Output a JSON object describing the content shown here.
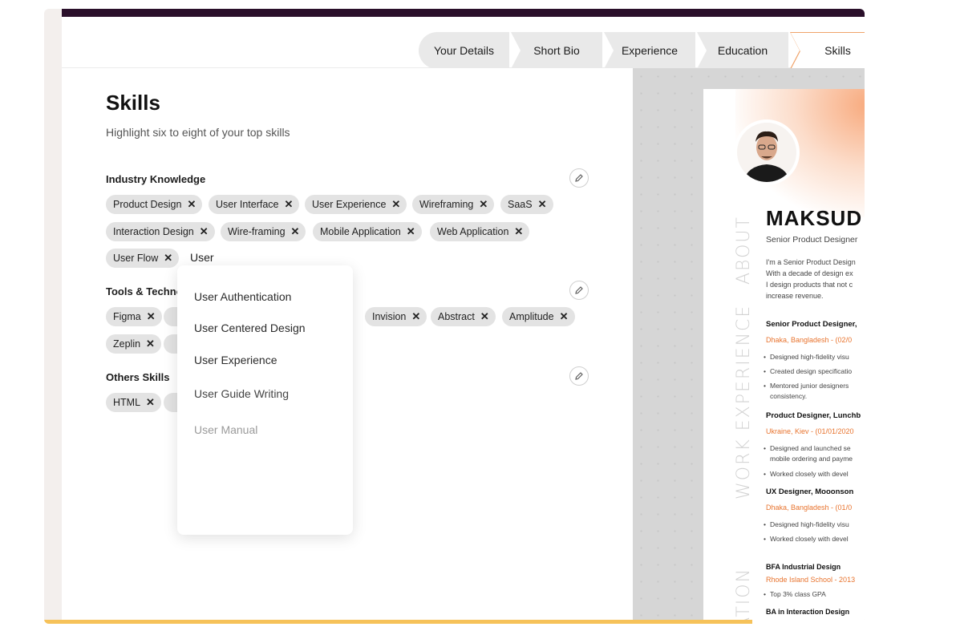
{
  "steps": [
    "Your Details",
    "Short Bio",
    "Experience",
    "Education",
    "Skills"
  ],
  "page": {
    "title": "Skills",
    "subtitle": "Highlight six to eight of your top skills"
  },
  "sections": {
    "industry": {
      "label": "Industry Knowledge",
      "chips": [
        "Product Design",
        "User Interface",
        "User Experience",
        "Wireframing",
        "SaaS",
        "Interaction Design",
        "Wire-framing",
        "Mobile Application",
        "Web Application",
        "User Flow"
      ],
      "typed": "User"
    },
    "tools": {
      "label": "Tools & Technologies",
      "chips": [
        "Figma",
        "Invision",
        "Abstract",
        "Amplitude",
        "Zeplin"
      ]
    },
    "others": {
      "label": "Others Skills",
      "chips": [
        "HTML"
      ]
    }
  },
  "dropdown": {
    "options": [
      "User Authentication",
      "User Centered Design",
      "User Experience",
      "User Guide Writing",
      "User Manual"
    ]
  },
  "resume": {
    "name": "MAKSUD",
    "role": "Senior Product Designer",
    "side_labels": [
      "ABOUT",
      "WORK EXPERIENCE",
      "ATION"
    ],
    "about": [
      "I'm a Senior Product Design",
      "With a decade of design ex",
      "I design products that not c",
      "increase revenue."
    ],
    "jobs": [
      {
        "title": "Senior Product Designer,",
        "meta": "Dhaka, Bangladesh - (02/0",
        "bullets": [
          "Designed high-fidelity visu",
          "Created design specificatio",
          "Mentored junior designers",
          "consistency."
        ]
      },
      {
        "title": "Product Designer, Lunchb",
        "meta": "Ukraine, Kiev - (01/01/2020",
        "bullets": [
          "Designed and launched se",
          "mobile ordering and payme",
          "Worked closely with devel"
        ]
      },
      {
        "title": "UX Designer, Mooonson",
        "meta": "Dhaka, Bangladesh - (01/0",
        "bullets": [
          "Designed high-fidelity visu",
          "Worked closely with devel"
        ]
      }
    ],
    "education": [
      {
        "title": "BFA Industrial Design",
        "meta": "Rhode Island School - 2013",
        "bullets": [
          "Top 3% class GPA"
        ]
      },
      {
        "title": "BA in Interaction Design"
      }
    ]
  },
  "colors": {
    "accent": "#f0a36a",
    "orange_text": "#e8742f",
    "header_bar": "#2a0f2a",
    "bottom_bar": "#f6c25a"
  }
}
